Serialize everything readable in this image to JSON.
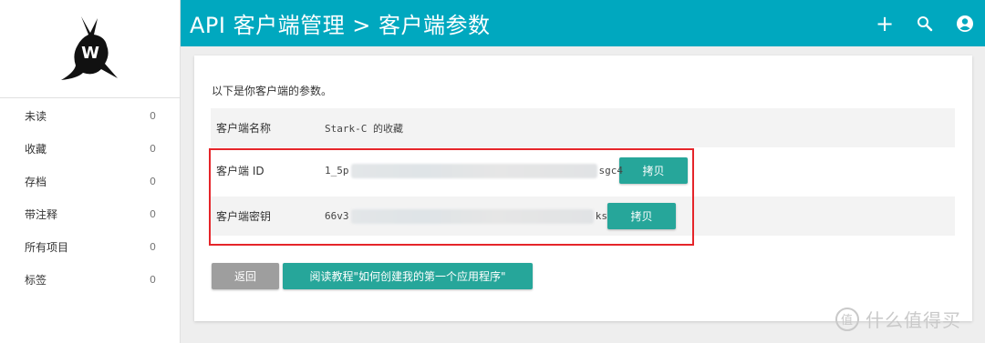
{
  "header": {
    "title": "API 客户端管理 > 客户端参数",
    "actions": [
      {
        "icon": "plus-icon",
        "label": "+"
      },
      {
        "icon": "search-icon"
      },
      {
        "icon": "account-icon"
      }
    ],
    "color": "#00a8bf"
  },
  "sidebar": {
    "items": [
      {
        "label": "未读",
        "count": "0"
      },
      {
        "label": "收藏",
        "count": "0"
      },
      {
        "label": "存档",
        "count": "0"
      },
      {
        "label": "带注释",
        "count": "0"
      },
      {
        "label": "所有项目",
        "count": "0"
      },
      {
        "label": "标签",
        "count": "0"
      }
    ]
  },
  "main": {
    "intro": "以下是你客户端的参数。",
    "client_name": {
      "label": "客户端名称",
      "value": "Stark-C 的收藏"
    },
    "client_id": {
      "label": "客户端 ID",
      "value_start": "1_5p",
      "value_end": "sgc4",
      "button": "拷贝"
    },
    "client_secret": {
      "label": "客户端密钥",
      "value_start": "66v3",
      "value_end": "ks",
      "button": "拷贝"
    },
    "back_button": "返回",
    "tutorial_button": "阅读教程\"如何创建我的第一个应用程序\""
  },
  "watermark": {
    "text": "什么值得买"
  },
  "colors": {
    "accent": "#00a8bf",
    "button": "#26a69a",
    "back_button": "#9e9e9e",
    "highlight": "#e5252a"
  }
}
